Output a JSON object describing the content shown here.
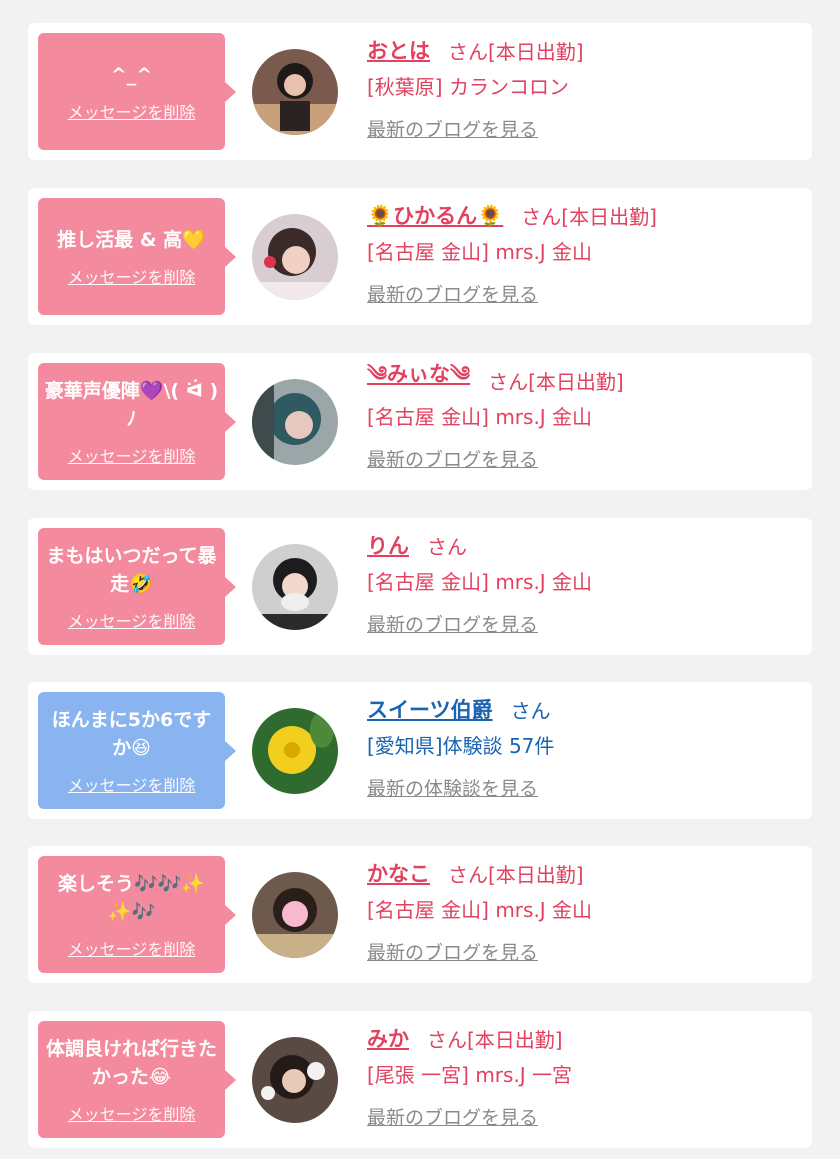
{
  "entries": [
    {
      "message": "^_^",
      "delete_label": "メッセージを削除",
      "name": "おとは",
      "suffix": "さん[本日出勤]",
      "shop": "[秋葉原] カランコロン",
      "link": "最新のブログを見る"
    },
    {
      "message": "推し活最 & 高💛",
      "delete_label": "メッセージを削除",
      "name": "🌻ひかるん🌻",
      "suffix": "さん[本日出勤]",
      "shop": "[名古屋 金山] mrs.J 金山",
      "link": "最新のブログを見る"
    },
    {
      "message": "豪華声優陣💜\\( ᐛ )ﾉ",
      "delete_label": "メッセージを削除",
      "name": "༄みぃな༄",
      "suffix": "さん[本日出勤]",
      "shop": "[名古屋 金山] mrs.J 金山",
      "link": "最新のブログを見る"
    },
    {
      "message": "まもはいつだって暴走🤣",
      "delete_label": "メッセージを削除",
      "name": "りん",
      "suffix": "さん",
      "shop": "[名古屋 金山] mrs.J 金山",
      "link": "最新のブログを見る"
    },
    {
      "message": "ほんまに5か6ですか😆",
      "delete_label": "メッセージを削除",
      "name": "スイーツ伯爵",
      "suffix": "さん",
      "shop": "[愛知県]体験談 57件",
      "link": "最新の体験談を見る"
    },
    {
      "message": "楽しそう🎶🎶✨✨🎶",
      "delete_label": "メッセージを削除",
      "name": "かなこ",
      "suffix": "さん[本日出勤]",
      "shop": "[名古屋 金山] mrs.J 金山",
      "link": "最新のブログを見る"
    },
    {
      "message": "体調良ければ行きたかった😂",
      "delete_label": "メッセージを削除",
      "name": "みか",
      "suffix": "さん[本日出勤]",
      "shop": "[尾張 一宮] mrs.J 一宮",
      "link": "最新のブログを見る"
    }
  ],
  "colors": {
    "pink_accent": "#e2415f",
    "blue_accent": "#1a64b2",
    "pink_bubble": "#f48a9d",
    "blue_bubble": "#8ab4f0",
    "link_gray": "#8a8a8a"
  }
}
